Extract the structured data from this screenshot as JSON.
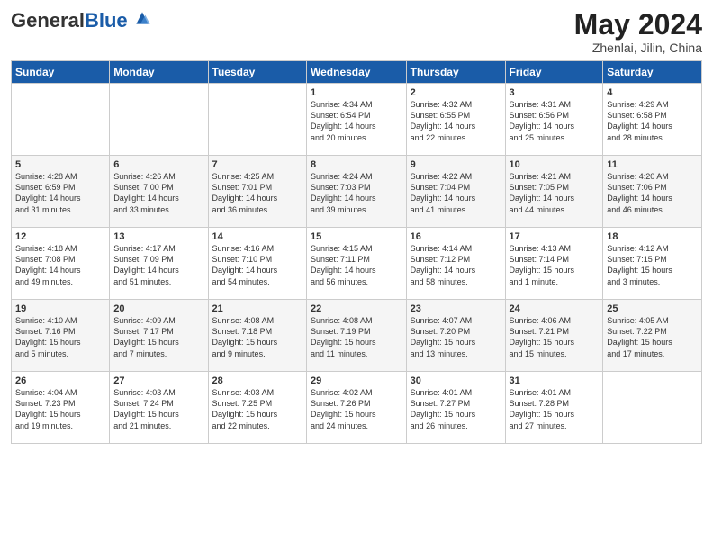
{
  "header": {
    "logo_general": "General",
    "logo_blue": "Blue",
    "month_title": "May 2024",
    "location": "Zhenlai, Jilin, China"
  },
  "days_of_week": [
    "Sunday",
    "Monday",
    "Tuesday",
    "Wednesday",
    "Thursday",
    "Friday",
    "Saturday"
  ],
  "weeks": [
    [
      {
        "day": "",
        "info": ""
      },
      {
        "day": "",
        "info": ""
      },
      {
        "day": "",
        "info": ""
      },
      {
        "day": "1",
        "info": "Sunrise: 4:34 AM\nSunset: 6:54 PM\nDaylight: 14 hours\nand 20 minutes."
      },
      {
        "day": "2",
        "info": "Sunrise: 4:32 AM\nSunset: 6:55 PM\nDaylight: 14 hours\nand 22 minutes."
      },
      {
        "day": "3",
        "info": "Sunrise: 4:31 AM\nSunset: 6:56 PM\nDaylight: 14 hours\nand 25 minutes."
      },
      {
        "day": "4",
        "info": "Sunrise: 4:29 AM\nSunset: 6:58 PM\nDaylight: 14 hours\nand 28 minutes."
      }
    ],
    [
      {
        "day": "5",
        "info": "Sunrise: 4:28 AM\nSunset: 6:59 PM\nDaylight: 14 hours\nand 31 minutes."
      },
      {
        "day": "6",
        "info": "Sunrise: 4:26 AM\nSunset: 7:00 PM\nDaylight: 14 hours\nand 33 minutes."
      },
      {
        "day": "7",
        "info": "Sunrise: 4:25 AM\nSunset: 7:01 PM\nDaylight: 14 hours\nand 36 minutes."
      },
      {
        "day": "8",
        "info": "Sunrise: 4:24 AM\nSunset: 7:03 PM\nDaylight: 14 hours\nand 39 minutes."
      },
      {
        "day": "9",
        "info": "Sunrise: 4:22 AM\nSunset: 7:04 PM\nDaylight: 14 hours\nand 41 minutes."
      },
      {
        "day": "10",
        "info": "Sunrise: 4:21 AM\nSunset: 7:05 PM\nDaylight: 14 hours\nand 44 minutes."
      },
      {
        "day": "11",
        "info": "Sunrise: 4:20 AM\nSunset: 7:06 PM\nDaylight: 14 hours\nand 46 minutes."
      }
    ],
    [
      {
        "day": "12",
        "info": "Sunrise: 4:18 AM\nSunset: 7:08 PM\nDaylight: 14 hours\nand 49 minutes."
      },
      {
        "day": "13",
        "info": "Sunrise: 4:17 AM\nSunset: 7:09 PM\nDaylight: 14 hours\nand 51 minutes."
      },
      {
        "day": "14",
        "info": "Sunrise: 4:16 AM\nSunset: 7:10 PM\nDaylight: 14 hours\nand 54 minutes."
      },
      {
        "day": "15",
        "info": "Sunrise: 4:15 AM\nSunset: 7:11 PM\nDaylight: 14 hours\nand 56 minutes."
      },
      {
        "day": "16",
        "info": "Sunrise: 4:14 AM\nSunset: 7:12 PM\nDaylight: 14 hours\nand 58 minutes."
      },
      {
        "day": "17",
        "info": "Sunrise: 4:13 AM\nSunset: 7:14 PM\nDaylight: 15 hours\nand 1 minute."
      },
      {
        "day": "18",
        "info": "Sunrise: 4:12 AM\nSunset: 7:15 PM\nDaylight: 15 hours\nand 3 minutes."
      }
    ],
    [
      {
        "day": "19",
        "info": "Sunrise: 4:10 AM\nSunset: 7:16 PM\nDaylight: 15 hours\nand 5 minutes."
      },
      {
        "day": "20",
        "info": "Sunrise: 4:09 AM\nSunset: 7:17 PM\nDaylight: 15 hours\nand 7 minutes."
      },
      {
        "day": "21",
        "info": "Sunrise: 4:08 AM\nSunset: 7:18 PM\nDaylight: 15 hours\nand 9 minutes."
      },
      {
        "day": "22",
        "info": "Sunrise: 4:08 AM\nSunset: 7:19 PM\nDaylight: 15 hours\nand 11 minutes."
      },
      {
        "day": "23",
        "info": "Sunrise: 4:07 AM\nSunset: 7:20 PM\nDaylight: 15 hours\nand 13 minutes."
      },
      {
        "day": "24",
        "info": "Sunrise: 4:06 AM\nSunset: 7:21 PM\nDaylight: 15 hours\nand 15 minutes."
      },
      {
        "day": "25",
        "info": "Sunrise: 4:05 AM\nSunset: 7:22 PM\nDaylight: 15 hours\nand 17 minutes."
      }
    ],
    [
      {
        "day": "26",
        "info": "Sunrise: 4:04 AM\nSunset: 7:23 PM\nDaylight: 15 hours\nand 19 minutes."
      },
      {
        "day": "27",
        "info": "Sunrise: 4:03 AM\nSunset: 7:24 PM\nDaylight: 15 hours\nand 21 minutes."
      },
      {
        "day": "28",
        "info": "Sunrise: 4:03 AM\nSunset: 7:25 PM\nDaylight: 15 hours\nand 22 minutes."
      },
      {
        "day": "29",
        "info": "Sunrise: 4:02 AM\nSunset: 7:26 PM\nDaylight: 15 hours\nand 24 minutes."
      },
      {
        "day": "30",
        "info": "Sunrise: 4:01 AM\nSunset: 7:27 PM\nDaylight: 15 hours\nand 26 minutes."
      },
      {
        "day": "31",
        "info": "Sunrise: 4:01 AM\nSunset: 7:28 PM\nDaylight: 15 hours\nand 27 minutes."
      },
      {
        "day": "",
        "info": ""
      }
    ]
  ]
}
